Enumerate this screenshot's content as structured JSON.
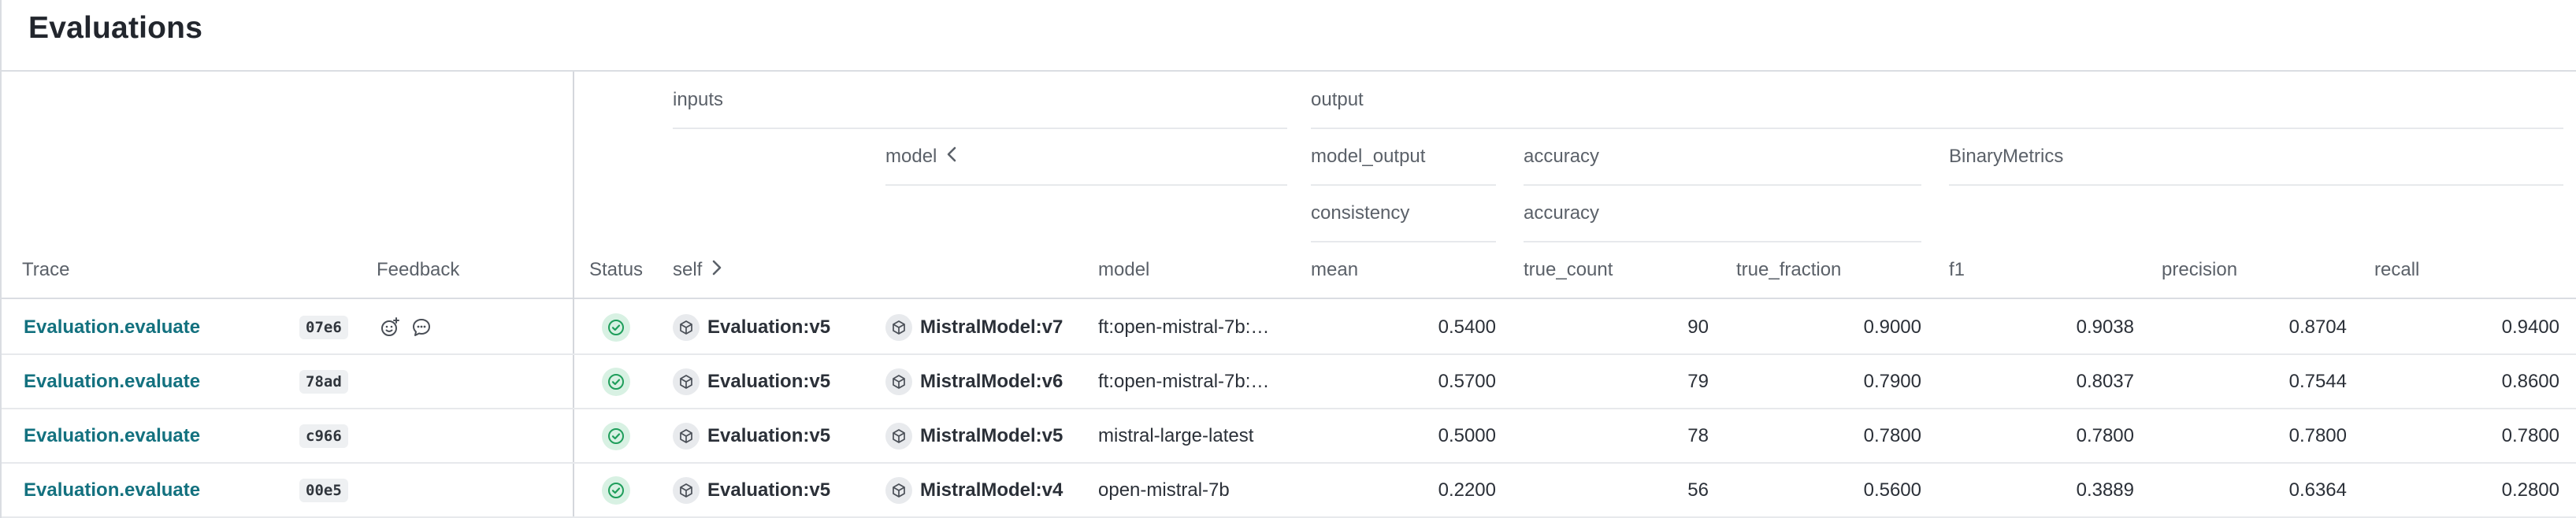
{
  "page": {
    "title": "Evaluations"
  },
  "header": {
    "trace": "Trace",
    "feedback": "Feedback",
    "status": "Status",
    "inputs": "inputs",
    "self": "self",
    "model_group": "model",
    "model": "model",
    "output": "output",
    "model_output": "model_output",
    "consistency": "consistency",
    "mean": "mean",
    "accuracy_1": "accuracy",
    "accuracy_2": "accuracy",
    "true_count": "true_count",
    "true_fraction": "true_fraction",
    "binary_metrics": "BinaryMetrics",
    "f1": "f1",
    "precision": "precision",
    "recall": "recall"
  },
  "rows": [
    {
      "trace": "Evaluation.evaluate",
      "id": "07e6",
      "has_feedback_icons": true,
      "status": "success",
      "self": "Evaluation:v5",
      "model_ref": "MistralModel:v7",
      "model": "ft:open-mistral-7b:…",
      "mean": "0.5400",
      "true_count": "90",
      "true_fraction": "0.9000",
      "f1": "0.9038",
      "precision": "0.8704",
      "recall": "0.9400"
    },
    {
      "trace": "Evaluation.evaluate",
      "id": "78ad",
      "has_feedback_icons": false,
      "status": "success",
      "self": "Evaluation:v5",
      "model_ref": "MistralModel:v6",
      "model": "ft:open-mistral-7b:…",
      "mean": "0.5700",
      "true_count": "79",
      "true_fraction": "0.7900",
      "f1": "0.8037",
      "precision": "0.7544",
      "recall": "0.8600"
    },
    {
      "trace": "Evaluation.evaluate",
      "id": "c966",
      "has_feedback_icons": false,
      "status": "success",
      "self": "Evaluation:v5",
      "model_ref": "MistralModel:v5",
      "model": "mistral-large-latest",
      "mean": "0.5000",
      "true_count": "78",
      "true_fraction": "0.7800",
      "f1": "0.7800",
      "precision": "0.7800",
      "recall": "0.7800"
    },
    {
      "trace": "Evaluation.evaluate",
      "id": "00e5",
      "has_feedback_icons": false,
      "status": "success",
      "self": "Evaluation:v5",
      "model_ref": "MistralModel:v4",
      "model": "open-mistral-7b",
      "mean": "0.2200",
      "true_count": "56",
      "true_fraction": "0.5600",
      "f1": "0.3889",
      "precision": "0.6364",
      "recall": "0.2800"
    }
  ],
  "icons": {
    "add_reaction": "smile-plus-icon",
    "comment": "speech-bubble-icon",
    "status": "check-circle-icon",
    "object": "cube-icon",
    "expand": "chevron-right-icon",
    "collapse": "chevron-left-icon"
  },
  "colors": {
    "link": "#13717f",
    "status_bg": "#d8f1e3",
    "status_fg": "#1f9e5b",
    "border": "#dadde2"
  }
}
